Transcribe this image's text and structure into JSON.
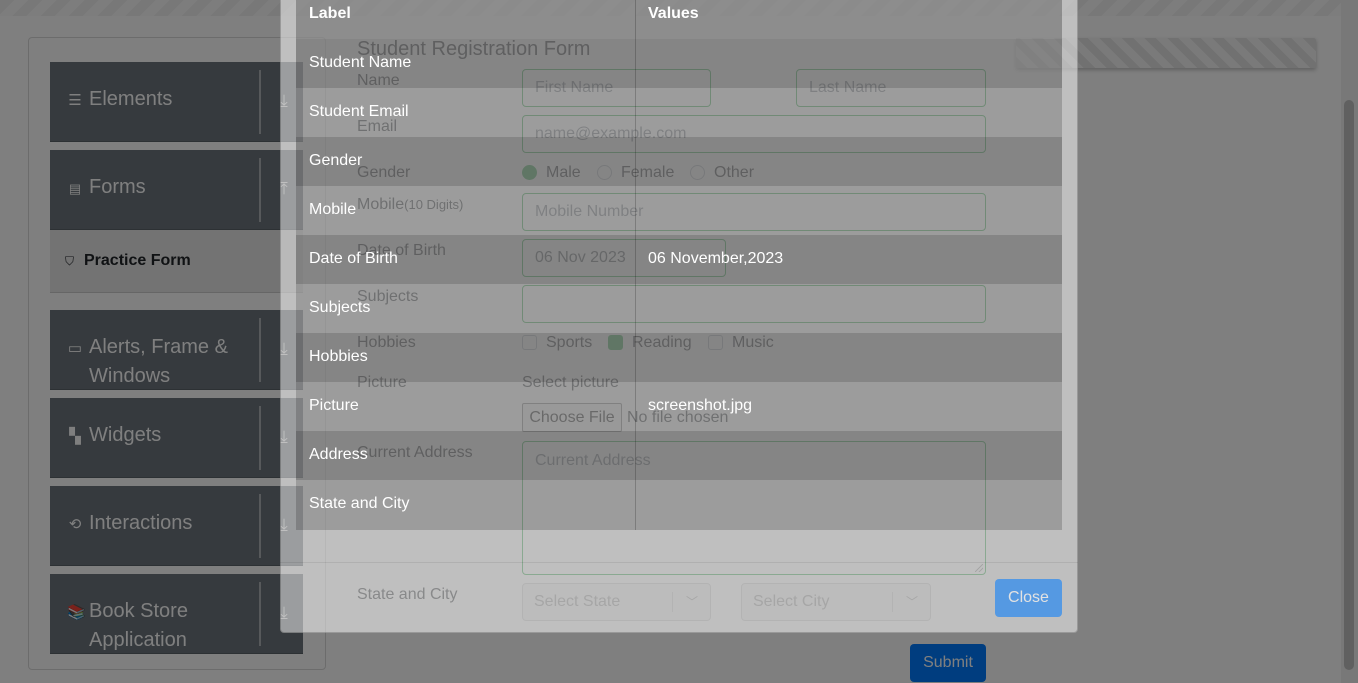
{
  "sidebar": {
    "categories": [
      {
        "label": "Elements",
        "icon": "hamburger-icon",
        "arrow": "download-icon"
      },
      {
        "label": "Forms",
        "icon": "document-icon",
        "arrow": "upload-icon"
      },
      {
        "label": "Alerts, Frame &",
        "label2": "Windows",
        "icon": "window-icon",
        "arrow": "download-icon"
      },
      {
        "label": "Widgets",
        "icon": "widgets-icon",
        "arrow": "download-icon"
      },
      {
        "label": "Interactions",
        "icon": "interactions-icon",
        "arrow": "download-icon"
      },
      {
        "label": "Book Store",
        "label2": "Application",
        "icon": "books-icon",
        "arrow": "download-icon"
      }
    ],
    "active_item": {
      "label": "Practice Form",
      "icon": "html5-icon"
    }
  },
  "form": {
    "title": "Student Registration Form",
    "name_label": "Name",
    "first_name_placeholder": "First Name",
    "last_name_placeholder": "Last Name",
    "email_label": "Email",
    "email_placeholder": "name@example.com",
    "gender_label": "Gender",
    "gender_options": [
      "Male",
      "Female",
      "Other"
    ],
    "gender_selected": "Male",
    "mobile_label": "Mobile",
    "mobile_hint": "(10 Digits)",
    "mobile_placeholder": "Mobile Number",
    "dob_label": "Date of Birth",
    "dob_value": "06 Nov 2023",
    "subjects_label": "Subjects",
    "hobbies_label": "Hobbies",
    "hobby_options": [
      "Sports",
      "Reading",
      "Music"
    ],
    "hobbies_checked": [
      "Reading"
    ],
    "picture_label": "Picture",
    "select_picture": "Select picture",
    "choose_file": "Choose File",
    "no_file": "No file chosen",
    "address_label": "Current Address",
    "address_placeholder": "Current Address",
    "state_city_label": "State and City",
    "state_placeholder": "Select State",
    "city_placeholder": "Select City",
    "submit": "Submit"
  },
  "modal": {
    "table": {
      "headers": [
        "Label",
        "Values"
      ],
      "rows": [
        {
          "label": "Student Name",
          "value": ""
        },
        {
          "label": "Student Email",
          "value": ""
        },
        {
          "label": "Gender",
          "value": ""
        },
        {
          "label": "Mobile",
          "value": ""
        },
        {
          "label": "Date of Birth",
          "value": "06 November,2023"
        },
        {
          "label": "Subjects",
          "value": ""
        },
        {
          "label": "Hobbies",
          "value": ""
        },
        {
          "label": "Picture",
          "value": "screenshot.jpg"
        },
        {
          "label": "Address",
          "value": ""
        },
        {
          "label": "State and City",
          "value": ""
        }
      ]
    },
    "close": "Close"
  },
  "colors": {
    "sidebar_bg": "#6c757d",
    "valid": "#28a745",
    "primary": "#007bff"
  }
}
